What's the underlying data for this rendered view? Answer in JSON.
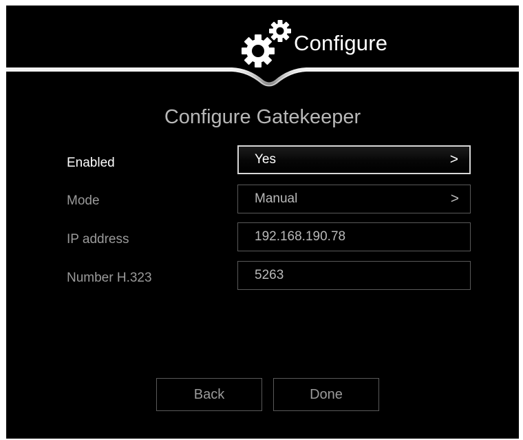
{
  "header": {
    "title": "Configure",
    "icon": "gears-icon"
  },
  "page": {
    "subtitle": "Configure Gatekeeper"
  },
  "form": {
    "enabled": {
      "label": "Enabled",
      "value": "Yes",
      "chevron": ">"
    },
    "mode": {
      "label": "Mode",
      "value": "Manual",
      "chevron": ">"
    },
    "ip_address": {
      "label": "IP address",
      "value": "192.168.190.78"
    },
    "number_h323": {
      "label": "Number H.323",
      "value": "5263"
    }
  },
  "buttons": {
    "back": "Back",
    "done": "Done"
  },
  "colors": {
    "background": "#000000",
    "label_active": "#ffffff",
    "label_inactive": "#9a9a9a",
    "field_border": "#5a5a5a",
    "selected_border": "#d8d8d8"
  }
}
